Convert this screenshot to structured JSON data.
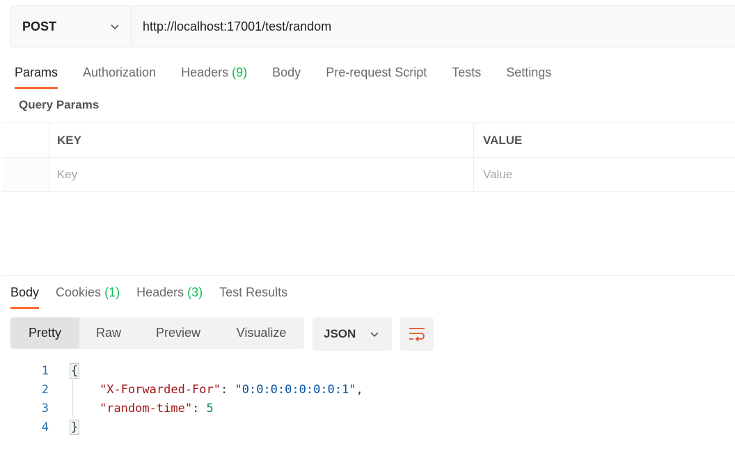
{
  "request": {
    "method": "POST",
    "url": "http://localhost:17001/test/random"
  },
  "request_tabs": [
    {
      "label": "Params",
      "count": ""
    },
    {
      "label": "Authorization",
      "count": ""
    },
    {
      "label": "Headers",
      "count": "(9)"
    },
    {
      "label": "Body",
      "count": ""
    },
    {
      "label": "Pre-request Script",
      "count": ""
    },
    {
      "label": "Tests",
      "count": ""
    },
    {
      "label": "Settings",
      "count": ""
    }
  ],
  "query_params": {
    "title": "Query Params",
    "col_key": "KEY",
    "col_value": "VALUE",
    "key_placeholder": "Key",
    "value_placeholder": "Value"
  },
  "response_tabs": [
    {
      "label": "Body",
      "count": ""
    },
    {
      "label": "Cookies",
      "count": "(1)"
    },
    {
      "label": "Headers",
      "count": "(3)"
    },
    {
      "label": "Test Results",
      "count": ""
    }
  ],
  "view_modes": [
    "Pretty",
    "Raw",
    "Preview",
    "Visualize"
  ],
  "format": "JSON",
  "code": {
    "line_numbers": [
      "1",
      "2",
      "3",
      "4"
    ],
    "open_brace": "{",
    "close_brace": "}",
    "entries": [
      {
        "key": "\"X-Forwarded-For\"",
        "sep": ": ",
        "value": "\"0:0:0:0:0:0:0:1\"",
        "trail": ","
      },
      {
        "key": "\"random-time\"",
        "sep": ": ",
        "value": "5",
        "trail": ""
      }
    ]
  },
  "colors": {
    "accent": "#ff6c37",
    "count": "#0cbb52"
  },
  "icons": {
    "method_dropdown": "chevron-down-icon",
    "format_dropdown": "chevron-down-icon",
    "wrap": "wrap-lines-icon"
  }
}
